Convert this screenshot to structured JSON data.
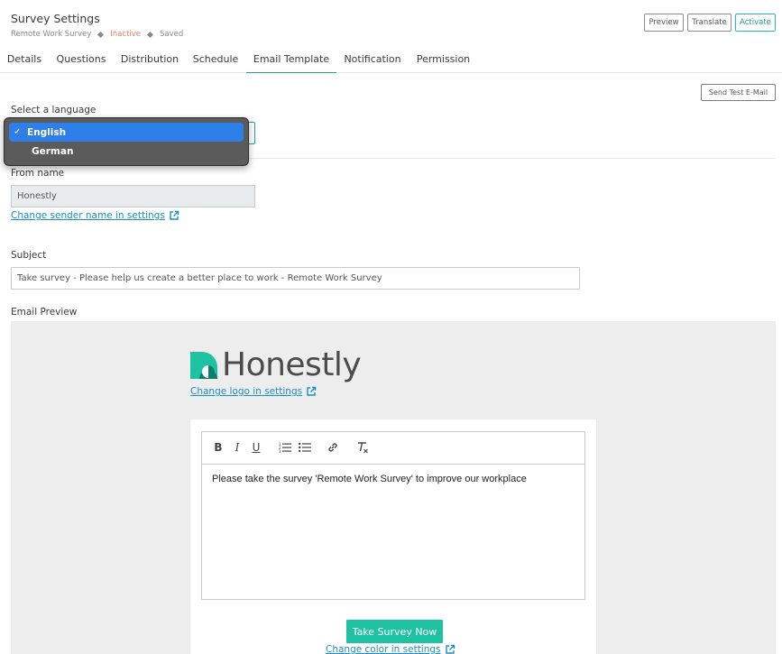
{
  "header": {
    "title": "Survey Settings",
    "survey_name": "Remote Work Survey",
    "status": "Inactive",
    "save_state": "Saved",
    "buttons": {
      "preview": "Preview",
      "translate": "Translate",
      "activate": "Activate"
    }
  },
  "tabs": [
    {
      "label": "Details"
    },
    {
      "label": "Questions"
    },
    {
      "label": "Distribution"
    },
    {
      "label": "Schedule"
    },
    {
      "label": "Email Template",
      "active": true
    },
    {
      "label": "Notification"
    },
    {
      "label": "Permission"
    }
  ],
  "send_test_label": "Send Test E-Mail",
  "language": {
    "label": "Select a language",
    "options": [
      "English",
      "German"
    ],
    "selected": "English"
  },
  "from_name": {
    "label": "From name",
    "value": "Honestly",
    "link": "Change sender name in settings"
  },
  "subject": {
    "label": "Subject",
    "value": "Take survey - Please help us create a better place to work - Remote Work Survey"
  },
  "preview": {
    "label": "Email Preview",
    "logo_text": "Honestly",
    "logo_link": "Change logo in settings",
    "body_text": "Please take the survey 'Remote Work Survey' to improve our workplace",
    "cta_label": "Take Survey Now",
    "color_link": "Change color in settings"
  },
  "colors": {
    "accent": "#1fa38c",
    "cta": "#1ec2a2",
    "link": "#1a8fc4",
    "inactive": "#e8806a",
    "dropdown_selected": "#2f7fe8"
  }
}
